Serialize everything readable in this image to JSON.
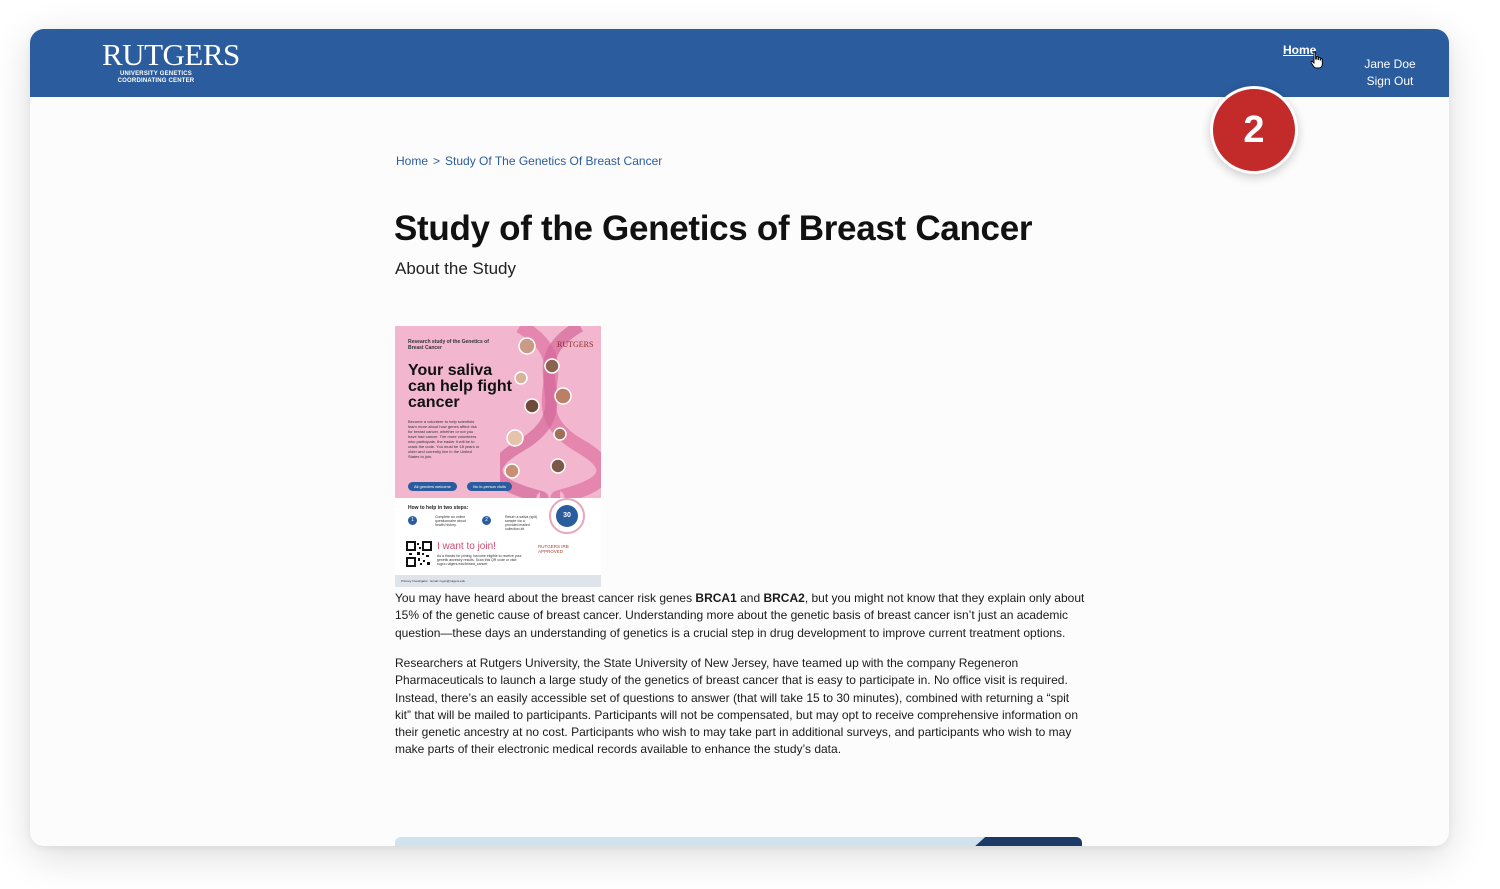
{
  "header": {
    "logo_main": "RUTGERS",
    "logo_sub_line1": "UNIVERSITY GENETICS",
    "logo_sub_line2": "COORDINATING CENTER",
    "nav_home": "Home",
    "user_name": "Jane Doe",
    "sign_out": "Sign Out",
    "bar_color": "#2b5c9d"
  },
  "step_badge": {
    "label": "2",
    "color": "#c32b2b"
  },
  "breadcrumb": {
    "items": [
      "Home",
      "Study Of The Genetics Of Breast Cancer"
    ],
    "separator": ">"
  },
  "page": {
    "title": "Study of the Genetics of Breast Cancer",
    "subtitle": "About the Study"
  },
  "flyer": {
    "header_text": "Research study of the Genetics of Breast Cancer",
    "logo": "RUTGERS",
    "headline": "Your saliva can help fight cancer",
    "body": "Become a volunteer to help scientists learn more about how genes affect risk for breast cancer, whether or not you have had cancer. The more volunteers who participate, the easier it will be to crack the code. You must be 18 years or older and currently live in the United States to join.",
    "pill1": "All genders welcome",
    "pill2": "No in-person visits",
    "how_to": "How to help in two steps:",
    "step1_num": "1",
    "step1": "Complete an online questionnaire about health history.",
    "step2_num": "2",
    "step2": "Return a saliva (spit) sample via a provided mailed collection kit.",
    "seal_value": "30",
    "join": "I want to join!",
    "join_desc": "As a thanks for joining, become eligible to receive your genetic ancestry results. Scan this QR code or visit: rugcc.rutgers.edu/breast_cancer",
    "irb": "RUTGERS IRB APPROVED",
    "footer": "Primary Investigator  ·  Email: rugcc@rutgers.edu"
  },
  "content": {
    "p1_a": "You may have heard about the breast cancer risk genes ",
    "p1_brca1": "BRCA1",
    "p1_and": " and ",
    "p1_brca2": "BRCA2",
    "p1_b": ", but you might not know that they explain only about 15% of the genetic cause of breast cancer. Understanding more about the genetic basis of breast cancer isn’t just an academic question—these days an understanding of genetics is a crucial step in drug development to improve current treatment options.",
    "p2": "Researchers at Rutgers University, the State University of New Jersey, have teamed up with the company Regeneron Pharmaceuticals to launch a large study of the genetics of breast cancer that is easy to participate in. No office visit is required. Instead, there’s an easily accessible set of questions to answer (that will take 15 to 30 minutes), combined with returning a “spit kit” that will be mailed to participants. Participants will not be compensated, but may opt to receive comprehensive information on their genetic ancestry at no cost. Participants who wish to may take part in additional surveys, and participants who wish to may make parts of their electronic medical records available to enhance the study’s data."
  }
}
